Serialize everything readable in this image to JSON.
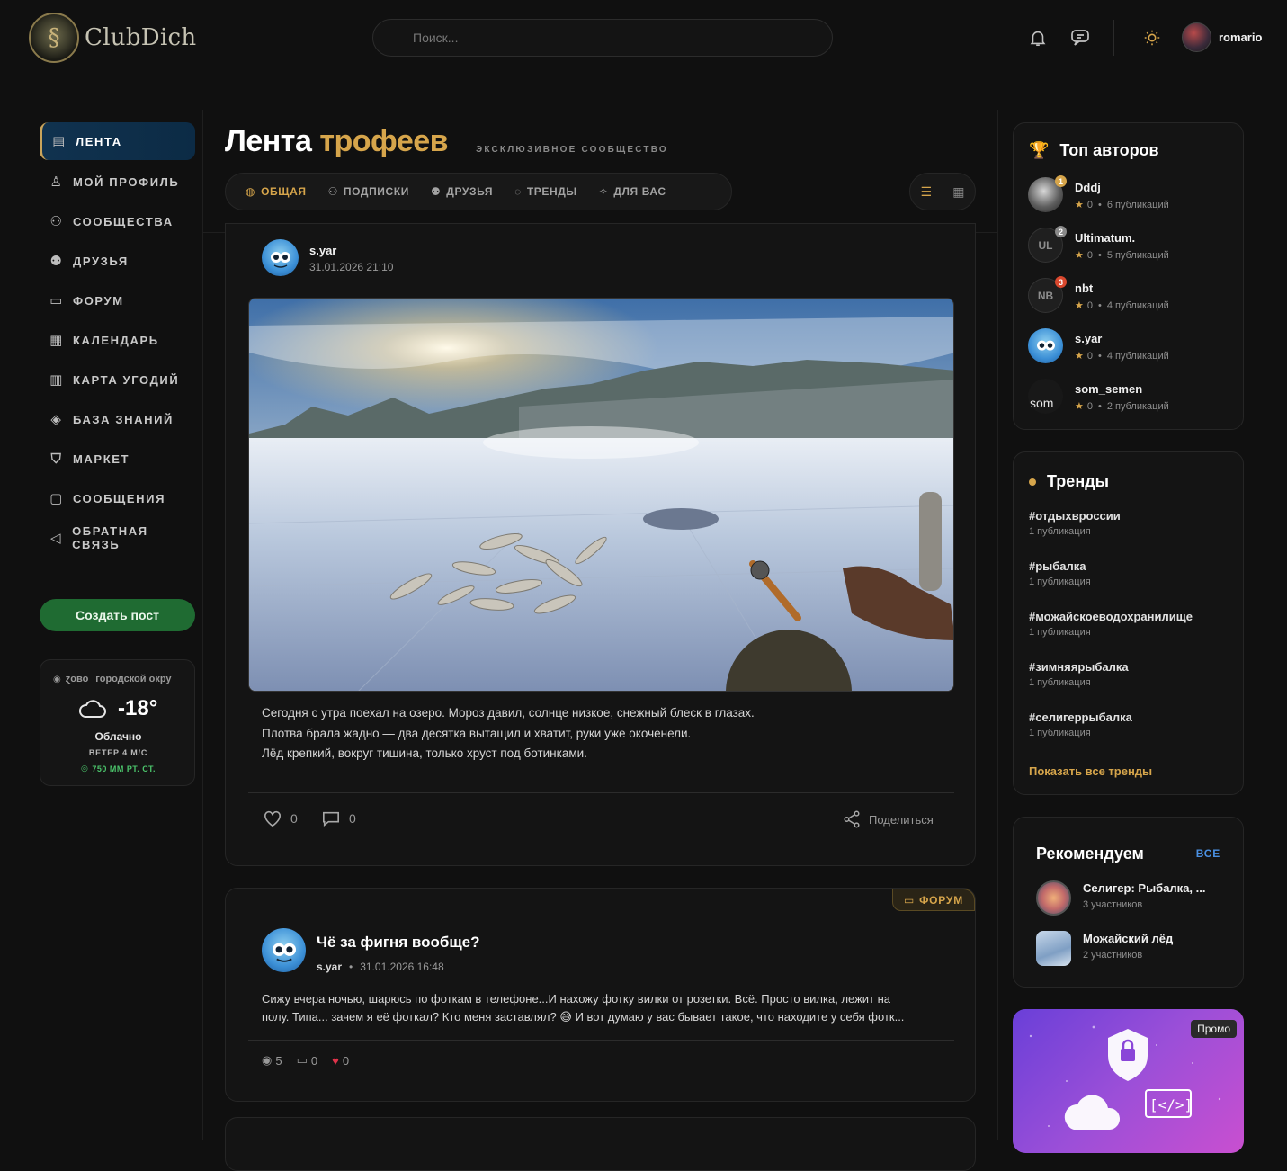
{
  "header": {
    "logo_text": "ClubDich",
    "search_placeholder": "Поиск...",
    "username": "romario",
    "icons": [
      "bell-icon",
      "chat-icon",
      "sun-icon"
    ]
  },
  "sidebar": {
    "items": [
      {
        "label": "ЛЕНТА",
        "icon": "feed-icon"
      },
      {
        "label": "МОЙ ПРОФИЛЬ",
        "icon": "user-icon"
      },
      {
        "label": "СООБЩЕСТВА",
        "icon": "users-icon"
      },
      {
        "label": "ДРУЗЬЯ",
        "icon": "friends-icon"
      },
      {
        "label": "ФОРУМ",
        "icon": "forum-icon"
      },
      {
        "label": "КАЛЕНДАРЬ",
        "icon": "calendar-icon"
      },
      {
        "label": "КАРТА УГОДИЙ",
        "icon": "map-icon"
      },
      {
        "label": "БАЗА ЗНАНИЙ",
        "icon": "knowledge-icon"
      },
      {
        "label": "МАРКЕТ",
        "icon": "bag-icon"
      },
      {
        "label": "СООБЩЕНИЯ",
        "icon": "messages-icon"
      },
      {
        "label": "ОБРАТНАЯ СВЯЗЬ",
        "icon": "megaphone-icon"
      }
    ],
    "create_label": "Создать пост",
    "weather": {
      "location_a": "ɀово",
      "location_b": "городской окру",
      "temp": "-18°",
      "condition": "Облачно",
      "wind": "ВЕТЕР 4 М/С",
      "pressure": "750 ММ РТ. СТ."
    }
  },
  "main": {
    "title_a": "Лента",
    "title_b": "трофеев",
    "subtitle": "ЭКСКЛЮЗИВНОЕ СООБЩЕСТВО",
    "tabs": [
      "ОБЩАЯ",
      "ПОДПИСКИ",
      "ДРУЗЬЯ",
      "ТРЕНДЫ",
      "ДЛЯ ВАС"
    ],
    "post1": {
      "author": "s.yar",
      "date": "31.01.2026 21:10",
      "lines": [
        "Сегодня с утра поехал на озеро. Мороз давил, солнце низкое, снежный блеск в глазах.",
        "Плотва брала жадно — два десятка вытащил и хватит, руки уже окоченели.",
        "Лёд крепкий, вокруг тишина, только хруст под ботинками."
      ],
      "likes": "0",
      "comments": "0",
      "share": "Поделиться"
    },
    "post2": {
      "badge": "ФОРУМ",
      "title": "Чё за фигня вообще?",
      "author": "s.yar",
      "date": "31.01.2026 16:48",
      "text_1": "Сижу вчера ночью, шарюсь по фоткам в телефоне...И нахожу фотку вилки от розетки. Всё. Просто вилка, лежит на",
      "text_2a": "полу. Типа... зачем я её фоткал? Кто меня заставлял?",
      "text_2b": "И вот думаю у вас бывает такое, что находите у себя фотк...",
      "views": "5",
      "comments": "0",
      "likes": "0"
    }
  },
  "right": {
    "top_title": "Топ авторов",
    "authors": [
      {
        "name": "Dddj",
        "rank": "1",
        "rating": "0",
        "pubs": "6 публикаций",
        "initials": ""
      },
      {
        "name": "Ultimatum.",
        "rank": "2",
        "rating": "0",
        "pubs": "5 публикаций",
        "initials": "UL"
      },
      {
        "name": "nbt",
        "rank": "3",
        "rating": "0",
        "pubs": "4 публикаций",
        "initials": "NB"
      },
      {
        "name": "s.yar",
        "rank": "",
        "rating": "0",
        "pubs": "4 публикаций",
        "initials": ""
      },
      {
        "name": "som_semen",
        "rank": "",
        "rating": "0",
        "pubs": "2 публикаций",
        "initials": "som"
      }
    ],
    "trends_title": "Тренды",
    "trends": [
      {
        "tag": "#отдыхвроссии",
        "count": "1 публикация"
      },
      {
        "tag": "#рыбалка",
        "count": "1 публикация"
      },
      {
        "tag": "#можайскоеводохранилище",
        "count": "1 публикация"
      },
      {
        "tag": "#зимняярыбалка",
        "count": "1 публикация"
      },
      {
        "tag": "#селигеррыбалка",
        "count": "1 публикация"
      }
    ],
    "trends_more": "Показать все тренды",
    "rec_title": "Рекомендуем",
    "rec_all": "ВСЕ",
    "recs": [
      {
        "name": "Селигер: Рыбалка, ...",
        "members": "3 участников"
      },
      {
        "name": "Можайский лёд",
        "members": "2 участников"
      }
    ],
    "promo_badge": "Промо"
  },
  "colors": {
    "accent": "#d6a54b",
    "active_nav": "#10324f",
    "create": "#1f6b32",
    "forum_badge": "#d6a54b",
    "promo_from": "#6a3fd8",
    "promo_to": "#c94fd0"
  }
}
